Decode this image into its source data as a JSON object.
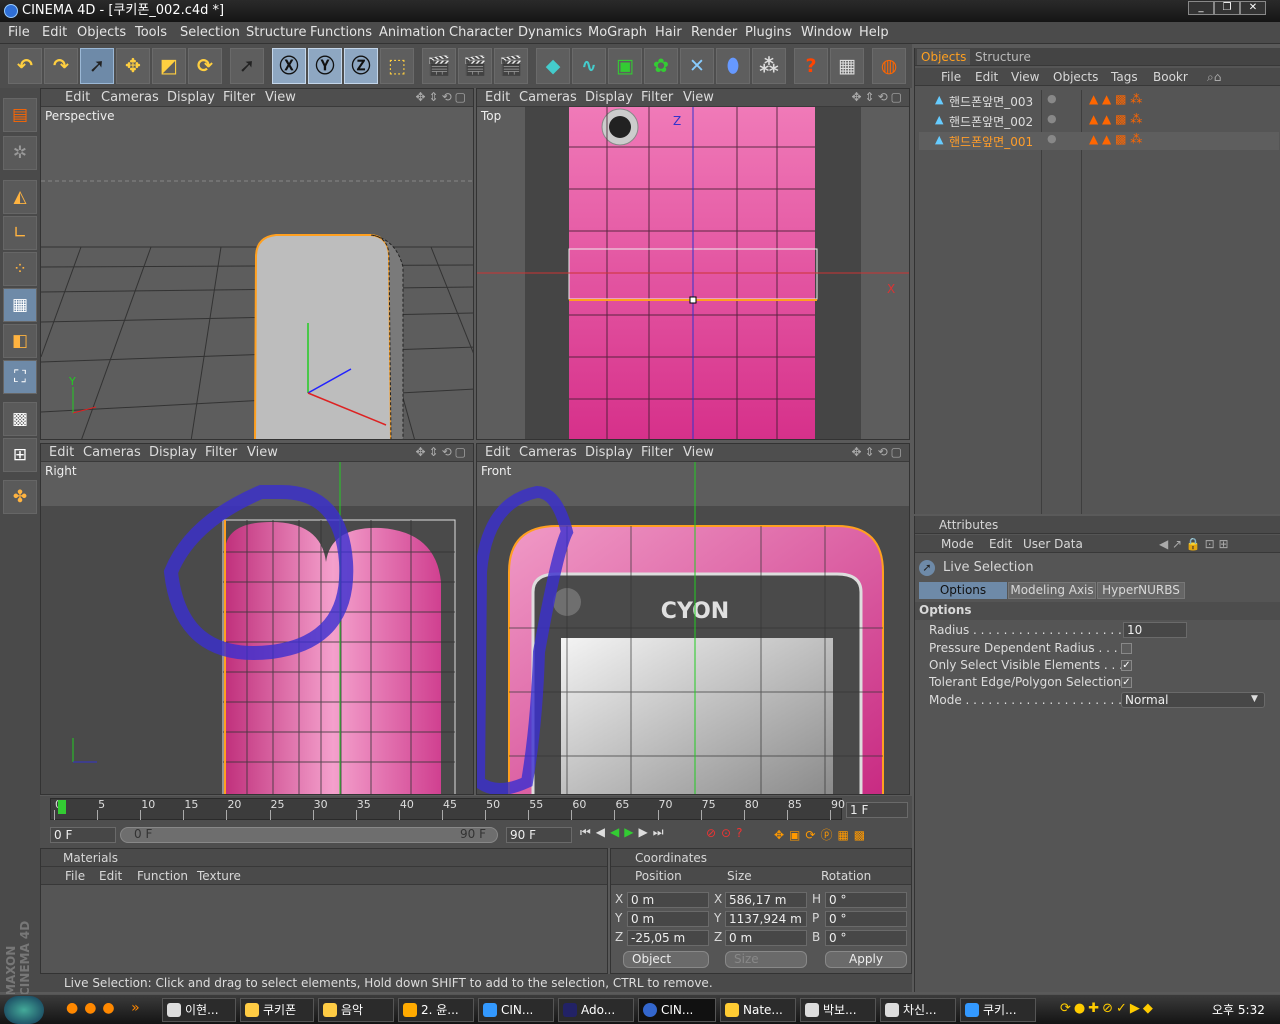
{
  "window": {
    "title": "CINEMA 4D - [쿠키폰_002.c4d *]"
  },
  "menu": [
    "File",
    "Edit",
    "Objects",
    "Tools",
    "Selection",
    "Structure",
    "Functions",
    "Animation",
    "Character",
    "Dynamics",
    "MoGraph",
    "Hair",
    "Render",
    "Plugins",
    "Window",
    "Help"
  ],
  "viewports": {
    "menu": [
      "Edit",
      "Cameras",
      "Display",
      "Filter",
      "View"
    ],
    "names": {
      "perspective": "Perspective",
      "top": "Top",
      "right": "Right",
      "front": "Front"
    },
    "axis_letters": {
      "x": "X",
      "y": "Y",
      "z": "Z"
    },
    "front_brand": "CYON"
  },
  "object_manager": {
    "tabs": [
      "Objects",
      "Structure"
    ],
    "menu": [
      "File",
      "Edit",
      "View",
      "Objects",
      "Tags",
      "Bookr"
    ],
    "objects": [
      {
        "name": "핸드폰앞면_003",
        "selected": false
      },
      {
        "name": "핸드폰앞면_002",
        "selected": false
      },
      {
        "name": "핸드폰앞면_001",
        "selected": true
      }
    ]
  },
  "attributes": {
    "title": "Attributes",
    "menu": [
      "Mode",
      "Edit",
      "User Data"
    ],
    "tool": "Live Selection",
    "tabs": [
      "Options",
      "Modeling Axis",
      "HyperNURBS"
    ],
    "section": "Options",
    "rows": [
      {
        "label": "Radius . . . . . . . . . . . . . . . . . . . . . . . .",
        "value": "10"
      },
      {
        "label": "Pressure Dependent Radius . . . .",
        "checked": false
      },
      {
        "label": "Only Select Visible Elements . . .",
        "checked": true
      },
      {
        "label": "Tolerant Edge/Polygon Selection",
        "checked": true
      },
      {
        "label": "Mode . . . . . . . . . . . . . . . . . . . . . . . . . .",
        "value": "Normal"
      }
    ]
  },
  "timeline": {
    "ticks": [
      "0",
      "5",
      "10",
      "15",
      "20",
      "25",
      "30",
      "35",
      "40",
      "45",
      "50",
      "55",
      "60",
      "65",
      "70",
      "75",
      "80",
      "85",
      "90"
    ],
    "current_frame": "1 F",
    "start": "0 F",
    "range_start": "0 F",
    "range_end": "90 F",
    "end": "90 F"
  },
  "materials": {
    "title": "Materials",
    "menu": [
      "File",
      "Edit",
      "Function",
      "Texture"
    ]
  },
  "coordinates": {
    "title": "Coordinates",
    "headers": [
      "Position",
      "Size",
      "Rotation"
    ],
    "rows": [
      {
        "axis": "X",
        "pos": "0 m",
        "size_axis": "X",
        "size": "586,17 m",
        "rot_axis": "H",
        "rot": "0 °"
      },
      {
        "axis": "Y",
        "pos": "0 m",
        "size_axis": "Y",
        "size": "1137,924 m",
        "rot_axis": "P",
        "rot": "0 °"
      },
      {
        "axis": "Z",
        "pos": "-25,05 m",
        "size_axis": "Z",
        "size": "0 m",
        "rot_axis": "B",
        "rot": "0 °"
      }
    ],
    "mode": "Object",
    "size_mode": "Size",
    "apply": "Apply"
  },
  "status": "Live Selection: Click and drag to select elements, Hold down SHIFT to add to the selection, CTRL to remove.",
  "taskbar": {
    "tasks": [
      "이현...",
      "쿠키폰",
      "음악",
      "2. 윤...",
      "CIN...",
      "Ado...",
      "CIN...",
      "Nate...",
      "박보...",
      "차신...",
      "쿠키..."
    ],
    "clock": "오후 5:32"
  },
  "logo": "MAXON CINEMA 4D",
  "colors": {
    "accent": "#ffa020",
    "selected_obj": "#ff9d2a",
    "phone_pink": "#e04f9a",
    "scribble": "#3a2ed0"
  }
}
